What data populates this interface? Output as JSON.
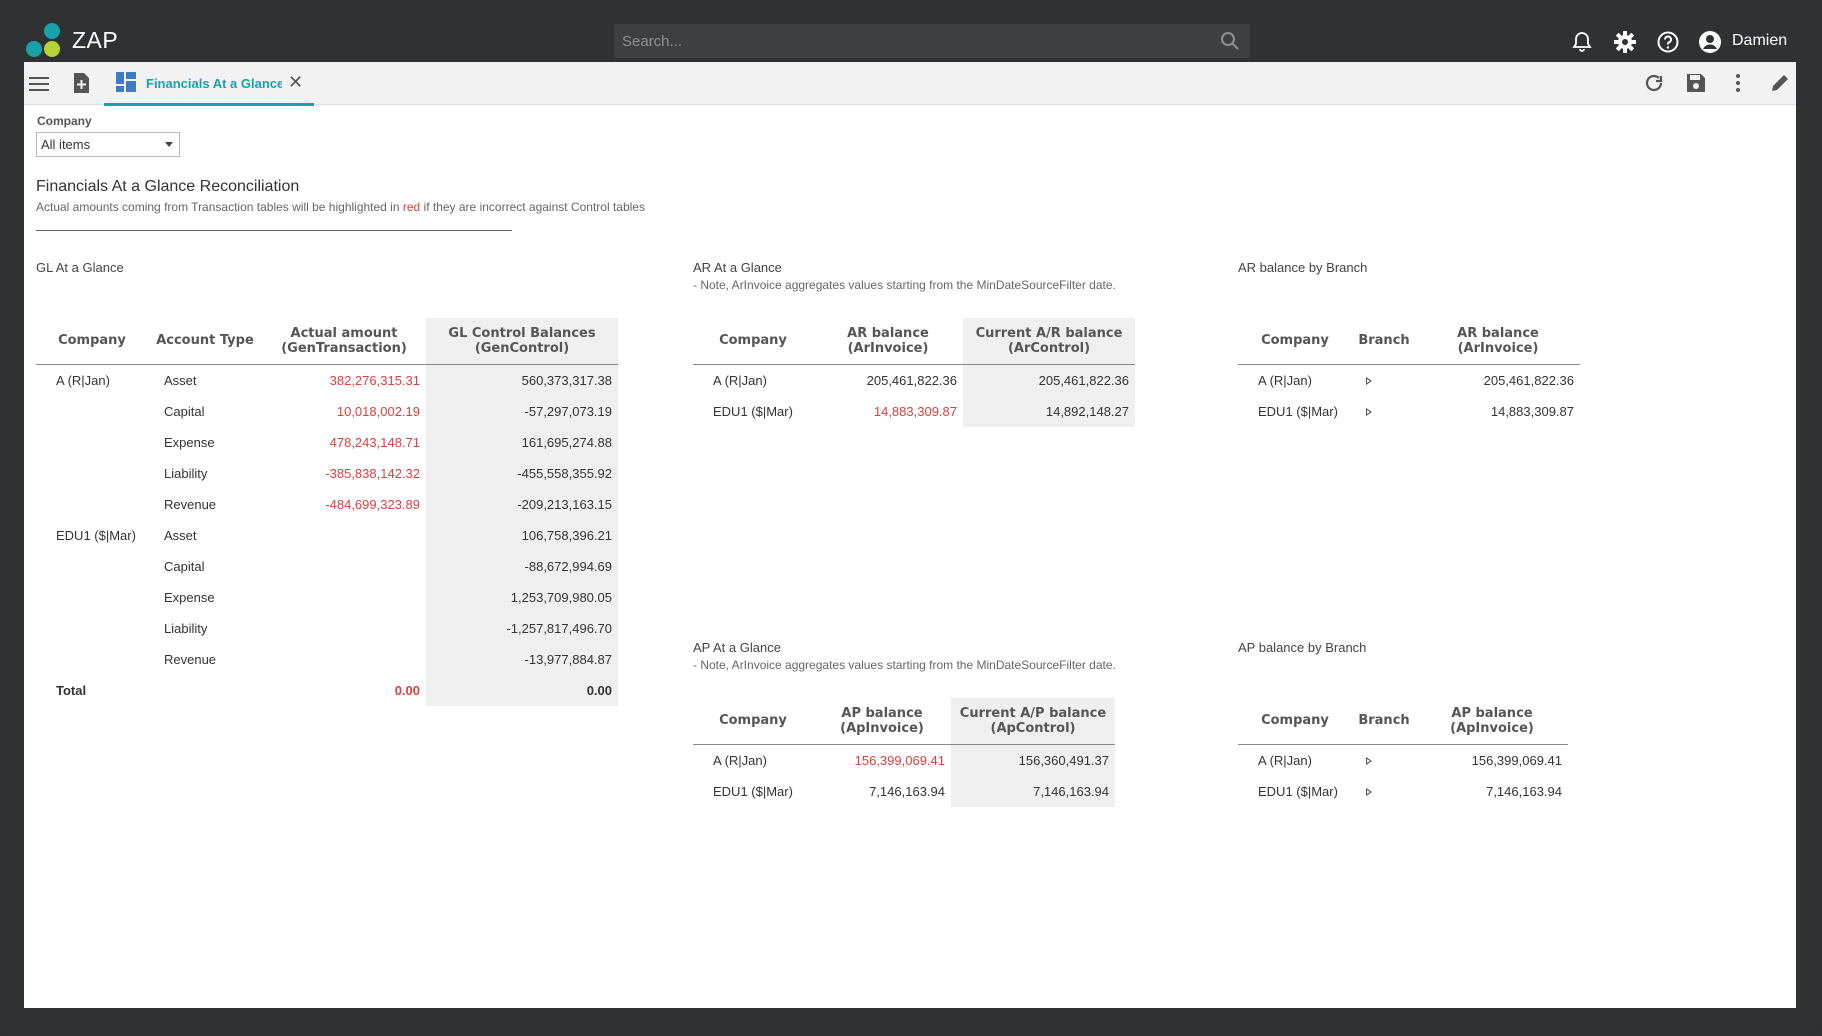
{
  "app": {
    "name": "ZAP",
    "user": "Damien"
  },
  "search": {
    "placeholder": "Search..."
  },
  "tab": {
    "label": "Financials At a Glance"
  },
  "filter": {
    "label": "Company",
    "value": "All items"
  },
  "page": {
    "title": "Financials At a Glance Reconciliation",
    "subtitle_before": "Actual amounts coming from Transaction tables will be highlighted in ",
    "subtitle_red": "red",
    "subtitle_after": " if they are incorrect against Control tables"
  },
  "colors": {
    "accent": "#17a2a8",
    "error": "#e23d3d",
    "shade": "#efefef",
    "topbar": "#2f3133"
  },
  "gl": {
    "title": "GL At a Glance",
    "headers": [
      "Company",
      "Account Type",
      "Actual amount (GenTransaction)",
      "GL Control Balances (GenControl)"
    ],
    "rows": [
      {
        "company": "A (R|Jan)",
        "type": "Asset",
        "actual": "382,276,315.31",
        "control": "560,373,317.38",
        "mismatch": true
      },
      {
        "company": "",
        "type": "Capital",
        "actual": "10,018,002.19",
        "control": "-57,297,073.19",
        "mismatch": true
      },
      {
        "company": "",
        "type": "Expense",
        "actual": "478,243,148.71",
        "control": "161,695,274.88",
        "mismatch": true
      },
      {
        "company": "",
        "type": "Liability",
        "actual": "-385,838,142.32",
        "control": "-455,558,355.92",
        "mismatch": true
      },
      {
        "company": "",
        "type": "Revenue",
        "actual": "-484,699,323.89",
        "control": "-209,213,163.15",
        "mismatch": true
      },
      {
        "company": "EDU1 ($|Mar)",
        "type": "Asset",
        "actual": "",
        "control": "106,758,396.21",
        "mismatch": false
      },
      {
        "company": "",
        "type": "Capital",
        "actual": "",
        "control": "-88,672,994.69",
        "mismatch": false
      },
      {
        "company": "",
        "type": "Expense",
        "actual": "",
        "control": "1,253,709,980.05",
        "mismatch": false
      },
      {
        "company": "",
        "type": "Liability",
        "actual": "",
        "control": "-1,257,817,496.70",
        "mismatch": false
      },
      {
        "company": "",
        "type": "Revenue",
        "actual": "",
        "control": "-13,977,884.87",
        "mismatch": false
      }
    ],
    "total": {
      "label": "Total",
      "actual": "0.00",
      "control": "0.00"
    }
  },
  "ar": {
    "title": "AR At a Glance",
    "note": "- Note, ArInvoice aggregates values starting from the MinDateSourceFilter date.",
    "headers": [
      "Company",
      "AR balance (ArInvoice)",
      "Current A/R balance (ArControl)"
    ],
    "rows": [
      {
        "company": "A (R|Jan)",
        "balance": "205,461,822.36",
        "control": "205,461,822.36",
        "mismatch": false
      },
      {
        "company": "EDU1 ($|Mar)",
        "balance": "14,883,309.87",
        "control": "14,892,148.27",
        "mismatch": true
      }
    ]
  },
  "ar_branch": {
    "title": "AR balance by Branch",
    "headers": [
      "Company",
      "Branch",
      "AR balance (ArInvoice)"
    ],
    "rows": [
      {
        "company": "A (R|Jan)",
        "balance": "205,461,822.36"
      },
      {
        "company": "EDU1 ($|Mar)",
        "balance": "14,883,309.87"
      }
    ]
  },
  "ap": {
    "title": "AP At a Glance",
    "note": "- Note, ArInvoice aggregates values starting from the MinDateSourceFilter date.",
    "headers": [
      "Company",
      "AP balance (ApInvoice)",
      "Current A/P balance (ApControl)"
    ],
    "rows": [
      {
        "company": "A (R|Jan)",
        "balance": "156,399,069.41",
        "control": "156,360,491.37",
        "mismatch": true
      },
      {
        "company": "EDU1 ($|Mar)",
        "balance": "7,146,163.94",
        "control": "7,146,163.94",
        "mismatch": false
      }
    ]
  },
  "ap_branch": {
    "title": "AP balance by Branch",
    "headers": [
      "Company",
      "Branch",
      "AP balance (ApInvoice)"
    ],
    "rows": [
      {
        "company": "A (R|Jan)",
        "balance": "156,399,069.41"
      },
      {
        "company": "EDU1 ($|Mar)",
        "balance": "7,146,163.94"
      }
    ]
  }
}
